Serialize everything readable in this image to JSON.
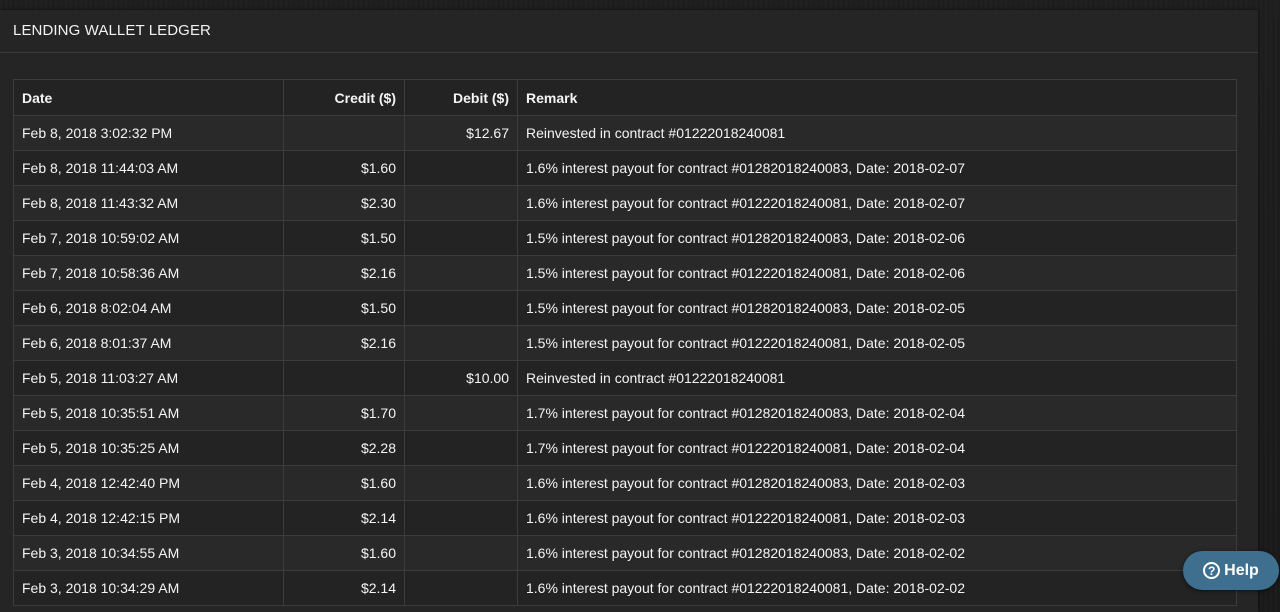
{
  "panel": {
    "title": "LENDING WALLET LEDGER"
  },
  "table": {
    "headers": {
      "date": "Date",
      "credit": "Credit ($)",
      "debit": "Debit ($)",
      "remark": "Remark"
    },
    "rows": [
      {
        "date": "Feb 8, 2018 3:02:32 PM",
        "credit": "",
        "debit": "$12.67",
        "remark": "Reinvested in contract #01222018240081"
      },
      {
        "date": "Feb 8, 2018 11:44:03 AM",
        "credit": "$1.60",
        "debit": "",
        "remark": "1.6% interest payout for contract #01282018240083, Date: 2018-02-07"
      },
      {
        "date": "Feb 8, 2018 11:43:32 AM",
        "credit": "$2.30",
        "debit": "",
        "remark": "1.6% interest payout for contract #01222018240081, Date: 2018-02-07"
      },
      {
        "date": "Feb 7, 2018 10:59:02 AM",
        "credit": "$1.50",
        "debit": "",
        "remark": "1.5% interest payout for contract #01282018240083, Date: 2018-02-06"
      },
      {
        "date": "Feb 7, 2018 10:58:36 AM",
        "credit": "$2.16",
        "debit": "",
        "remark": "1.5% interest payout for contract #01222018240081, Date: 2018-02-06"
      },
      {
        "date": "Feb 6, 2018 8:02:04 AM",
        "credit": "$1.50",
        "debit": "",
        "remark": "1.5% interest payout for contract #01282018240083, Date: 2018-02-05"
      },
      {
        "date": "Feb 6, 2018 8:01:37 AM",
        "credit": "$2.16",
        "debit": "",
        "remark": "1.5% interest payout for contract #01222018240081, Date: 2018-02-05"
      },
      {
        "date": "Feb 5, 2018 11:03:27 AM",
        "credit": "",
        "debit": "$10.00",
        "remark": "Reinvested in contract #01222018240081"
      },
      {
        "date": "Feb 5, 2018 10:35:51 AM",
        "credit": "$1.70",
        "debit": "",
        "remark": "1.7% interest payout for contract #01282018240083, Date: 2018-02-04"
      },
      {
        "date": "Feb 5, 2018 10:35:25 AM",
        "credit": "$2.28",
        "debit": "",
        "remark": "1.7% interest payout for contract #01222018240081, Date: 2018-02-04"
      },
      {
        "date": "Feb 4, 2018 12:42:40 PM",
        "credit": "$1.60",
        "debit": "",
        "remark": "1.6% interest payout for contract #01282018240083, Date: 2018-02-03"
      },
      {
        "date": "Feb 4, 2018 12:42:15 PM",
        "credit": "$2.14",
        "debit": "",
        "remark": "1.6% interest payout for contract #01222018240081, Date: 2018-02-03"
      },
      {
        "date": "Feb 3, 2018 10:34:55 AM",
        "credit": "$1.60",
        "debit": "",
        "remark": "1.6% interest payout for contract #01282018240083, Date: 2018-02-02"
      },
      {
        "date": "Feb 3, 2018 10:34:29 AM",
        "credit": "$2.14",
        "debit": "",
        "remark": "1.6% interest payout for contract #01222018240081, Date: 2018-02-02"
      }
    ]
  },
  "help_button": {
    "icon": "question-circle-icon",
    "icon_glyph": "?",
    "label": "Help"
  }
}
